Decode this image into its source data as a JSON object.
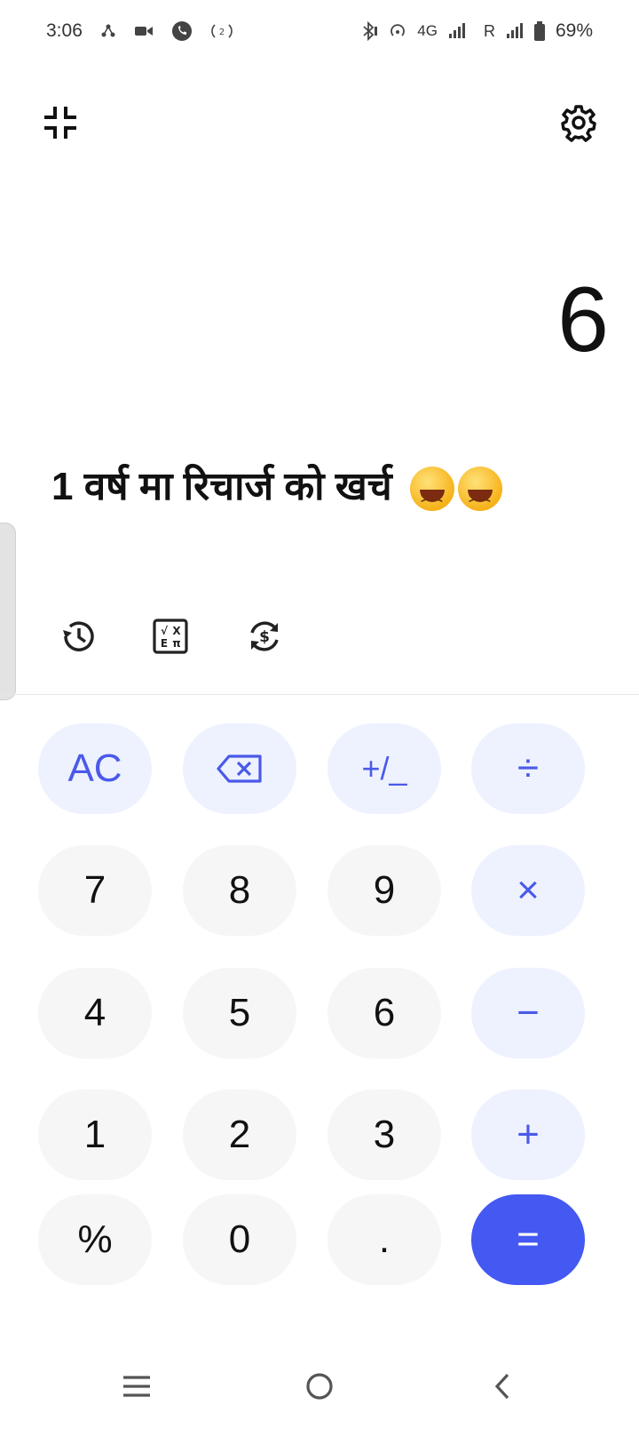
{
  "status_bar": {
    "time": "3:06",
    "network": "4G",
    "roaming": "R",
    "battery": "69%"
  },
  "display": {
    "result": "6",
    "expression": "1 वर्ष मा रिचार्ज को खर्च"
  },
  "keypad": {
    "row1": [
      "AC",
      "backspace-icon",
      "+/_",
      "÷"
    ],
    "row2": [
      "7",
      "8",
      "9",
      "×"
    ],
    "row3": [
      "4",
      "5",
      "6",
      "−"
    ],
    "row4": [
      "1",
      "2",
      "3",
      "+"
    ],
    "row5": [
      "%",
      "0",
      ".",
      "="
    ],
    "labels": {
      "ac": "AC",
      "sign": "+/_",
      "divide": "÷",
      "multiply": "×",
      "minus": "−",
      "plus": "+",
      "percent": "%",
      "dot": ".",
      "equals": "=",
      "n0": "0",
      "n1": "1",
      "n2": "2",
      "n3": "3",
      "n4": "4",
      "n5": "5",
      "n6": "6",
      "n7": "7",
      "n8": "8",
      "n9": "9"
    }
  },
  "colors": {
    "accent": "#4458f2",
    "function_bg": "#eef2ff",
    "function_text": "#4a5ae8",
    "digit_bg": "#f6f6f6"
  },
  "icons": {
    "collapse": "collapse-icon",
    "settings": "gear-icon",
    "history": "history-icon",
    "scientific": "scientific-icon",
    "currency": "currency-convert-icon",
    "nav_menu": "menu-icon",
    "nav_home": "home-icon",
    "nav_back": "back-icon"
  }
}
